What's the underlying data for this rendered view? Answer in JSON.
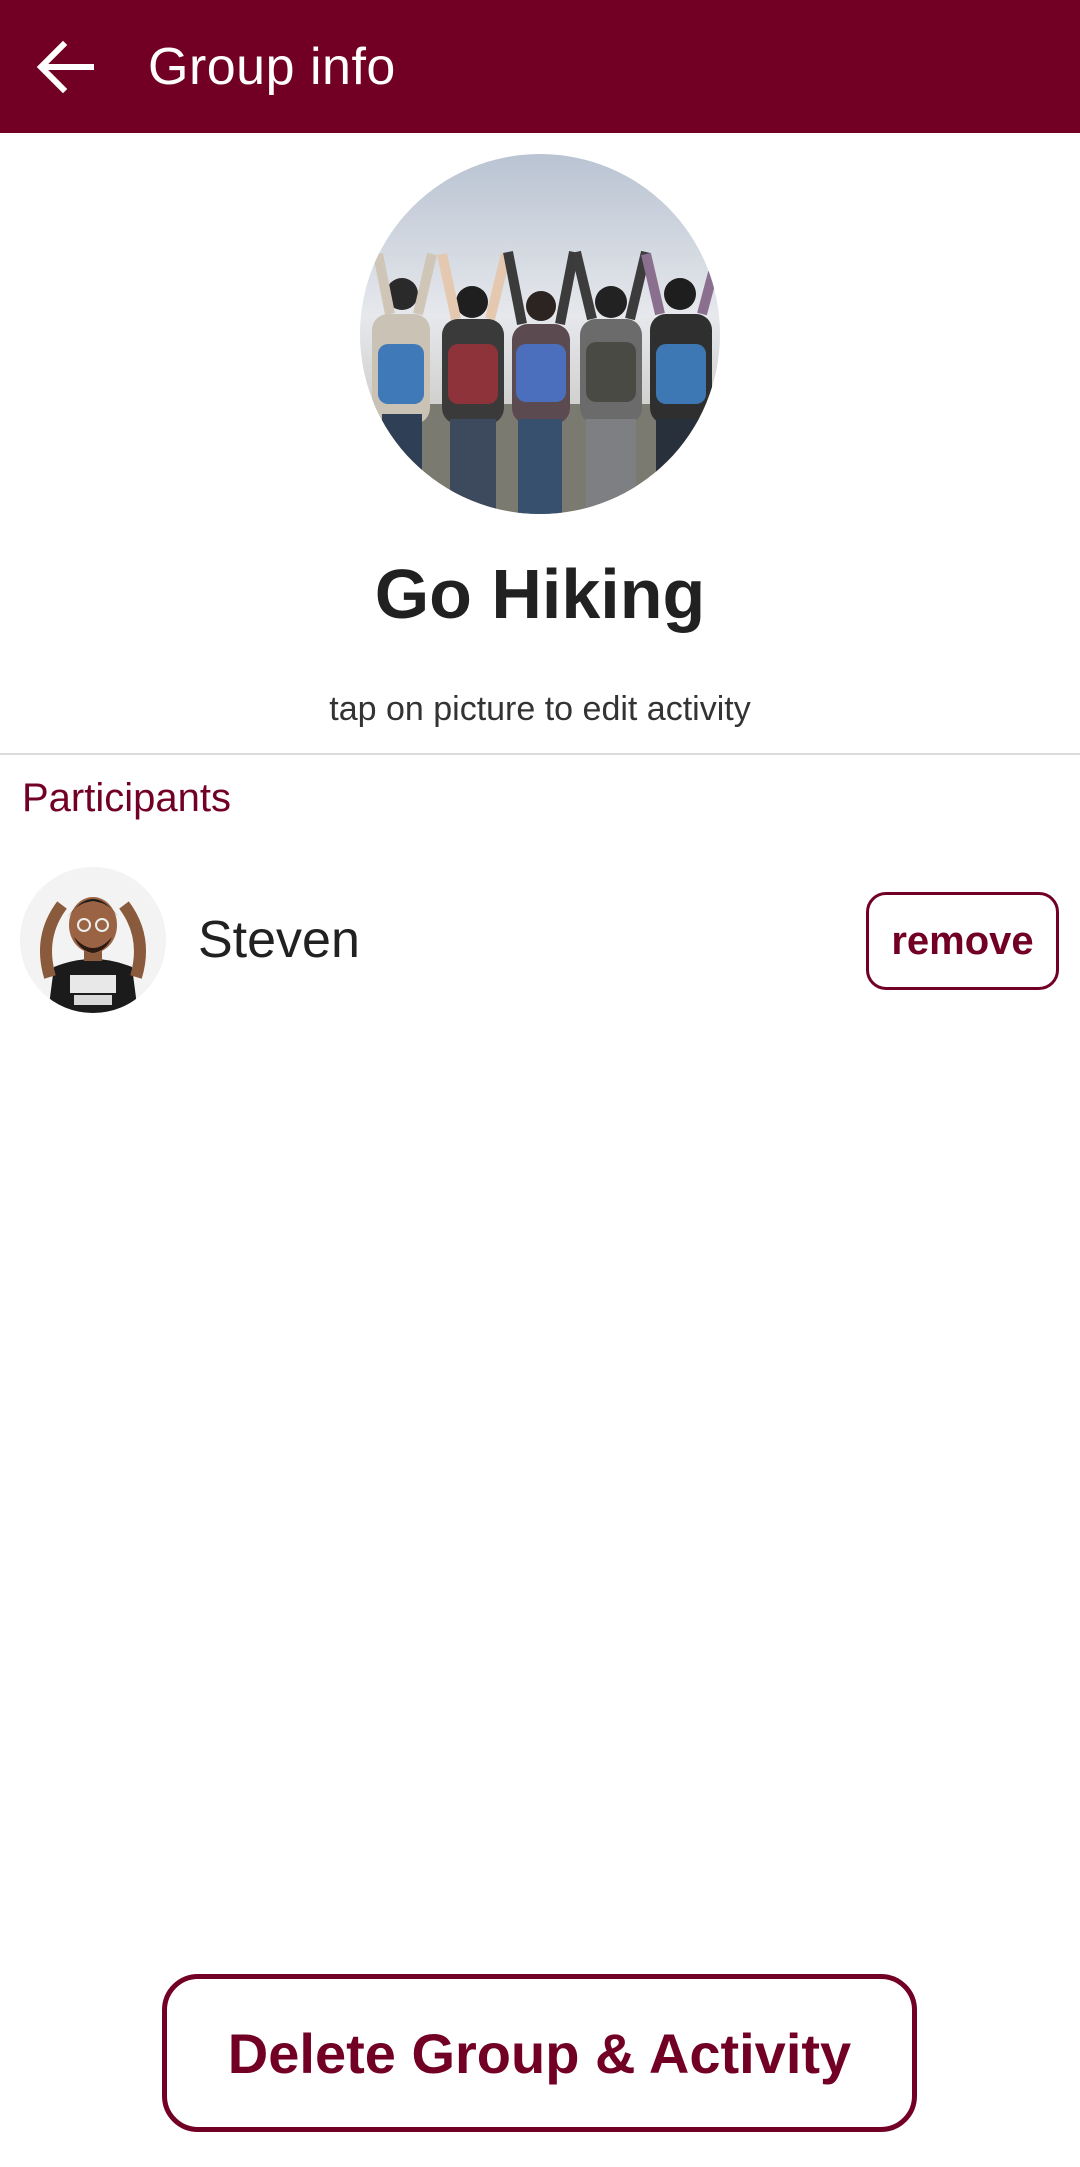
{
  "appbar": {
    "title": "Group info",
    "back_icon": "arrow-left-icon",
    "color": "#720025"
  },
  "group": {
    "name": "Go Hiking",
    "hint": "tap on picture to edit activity",
    "picture_icon": "group-photo"
  },
  "participants": {
    "title": "Participants",
    "items": [
      {
        "name": "Steven",
        "action_label": "remove",
        "avatar_icon": "person-avatar"
      }
    ]
  },
  "footer": {
    "delete_label": "Delete Group & Activity"
  },
  "colors": {
    "accent": "#720025",
    "text": "#212121",
    "divider": "#dcdcdc"
  }
}
